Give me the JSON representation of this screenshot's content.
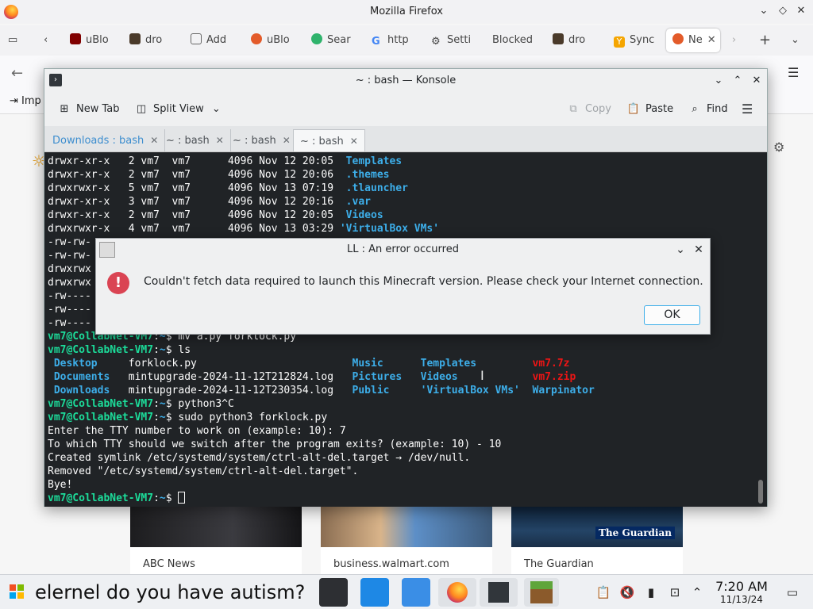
{
  "firefox": {
    "window_title": "Mozilla Firefox",
    "tabs": [
      {
        "label": "uBlo"
      },
      {
        "label": "dro"
      },
      {
        "label": "Add"
      },
      {
        "label": "uBlo"
      },
      {
        "label": "Sear"
      },
      {
        "label": "http"
      },
      {
        "label": "Setti"
      },
      {
        "label": "Blocked"
      },
      {
        "label": "dro"
      },
      {
        "label": "Sync"
      },
      {
        "label": "Ne"
      }
    ],
    "bookmark": "Imp",
    "news_cards": [
      {
        "label": "ABC News"
      },
      {
        "label": "business.walmart.com"
      },
      {
        "label": "The Guardian"
      }
    ],
    "guardian_logo": "The Guardian"
  },
  "konsole": {
    "title": "~ : bash — Konsole",
    "toolbar": {
      "new_tab": "New Tab",
      "split_view": "Split View",
      "copy": "Copy",
      "paste": "Paste",
      "find": "Find"
    },
    "tabs": [
      {
        "label": "Downloads : bash"
      },
      {
        "label": "~ : bash"
      },
      {
        "label": "~ : bash"
      },
      {
        "label": "~ : bash"
      }
    ],
    "listing": [
      {
        "perm": "drwxr-xr-x   2 vm7  vm7      4096 Nov 12 20:05",
        "name": "Templates"
      },
      {
        "perm": "drwxr-xr-x   2 vm7  vm7      4096 Nov 12 20:06",
        "name": ".themes"
      },
      {
        "perm": "drwxrwxr-x   5 vm7  vm7      4096 Nov 13 07:19",
        "name": ".tlauncher"
      },
      {
        "perm": "drwxr-xr-x   3 vm7  vm7      4096 Nov 12 20:16",
        "name": ".var"
      },
      {
        "perm": "drwxr-xr-x   2 vm7  vm7      4096 Nov 12 20:05",
        "name": "Videos"
      },
      {
        "perm": "drwxrwxr-x   4 vm7  vm7      4096 Nov 13 03:29",
        "name": "'VirtualBox VMs'"
      }
    ],
    "partial_lines": [
      "-rw-rw-",
      "-rw-rw-",
      "drwxrwx",
      "drwxrwx",
      "-rw----",
      "-rw----",
      "-rw----"
    ],
    "prompt": "vm7@CollabNet-VM7",
    "cmd_mv": "mv a.py forklock.py",
    "cmd_ls": "ls",
    "ls_output": [
      [
        {
          "t": "Desktop",
          "c": "dir"
        },
        {
          "t": "forklock.py",
          "c": ""
        },
        {
          "t": "Music",
          "c": "dir"
        },
        {
          "t": "Templates",
          "c": "dir"
        },
        {
          "t": "vm7.7z",
          "c": "exe"
        }
      ],
      [
        {
          "t": "Documents",
          "c": "dir"
        },
        {
          "t": "mintupgrade-2024-11-12T212824.log",
          "c": ""
        },
        {
          "t": "Pictures",
          "c": "dir"
        },
        {
          "t": "Videos",
          "c": "dir"
        },
        {
          "t": "vm7.zip",
          "c": "exe"
        }
      ],
      [
        {
          "t": "Downloads",
          "c": "dir"
        },
        {
          "t": "mintupgrade-2024-11-12T230354.log",
          "c": ""
        },
        {
          "t": "Public",
          "c": "dir"
        },
        {
          "t": "'VirtualBox VMs'",
          "c": "dir"
        },
        {
          "t": "Warpinator",
          "c": "dir"
        }
      ]
    ],
    "cmd_python": "python3^C",
    "cmd_sudo": "sudo python3 forklock.py",
    "output": [
      "Enter the TTY number to work on (example: 10): 7",
      "To which TTY should we switch after the program exits? (example: 10) - 10",
      "Created symlink /etc/systemd/system/ctrl-alt-del.target → /dev/null.",
      "Removed \"/etc/systemd/system/ctrl-alt-del.target\".",
      "Bye!"
    ]
  },
  "dialog": {
    "title": "LL : An error occurred",
    "message": "Couldn't fetch data required to launch this Minecraft version. Please check your Internet connection.",
    "ok": "OK"
  },
  "taskbar": {
    "search_text": "elernel do you have autism?",
    "time": "7:20 AM",
    "date": "11/13/24"
  }
}
